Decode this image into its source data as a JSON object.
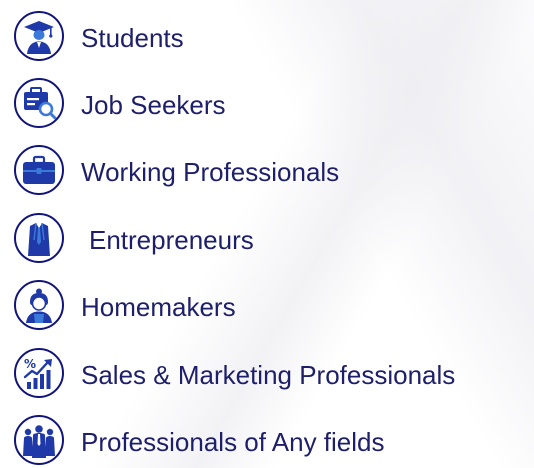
{
  "audience_list": {
    "items": [
      {
        "label": "Students",
        "icon": "graduate-icon"
      },
      {
        "label": "Job Seekers",
        "icon": "job-search-icon"
      },
      {
        "label": "Working Professionals",
        "icon": "briefcase-icon"
      },
      {
        "label": "Entrepreneurs",
        "icon": "businessman-suit-icon"
      },
      {
        "label": "Homemakers",
        "icon": "homemaker-icon"
      },
      {
        "label": "Sales & Marketing Professionals",
        "icon": "sales-growth-chart-icon"
      },
      {
        "label": "Professionals of Any fields",
        "icon": "group-of-people-icon"
      }
    ]
  },
  "colors": {
    "label_text": "#1e1f6b",
    "icon_border": "#11147a",
    "icon_fill": "#1f3aa8",
    "icon_accent": "#3b7ad9"
  }
}
